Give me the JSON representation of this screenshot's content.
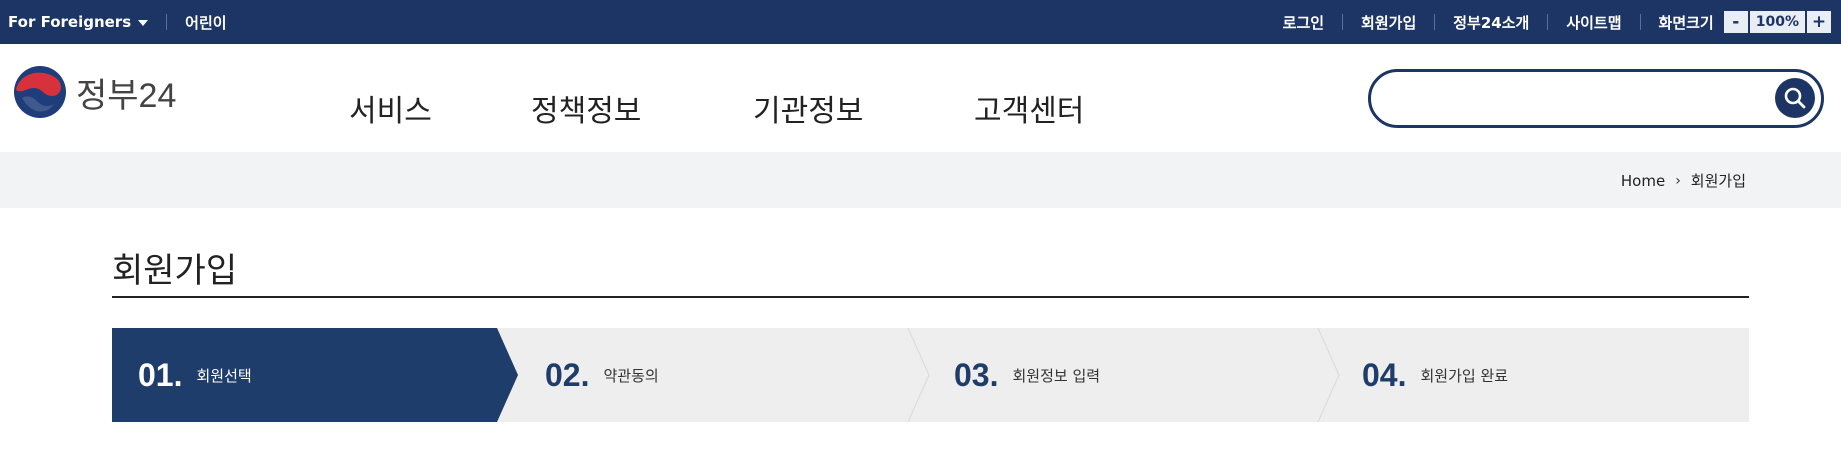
{
  "topbar": {
    "foreigners_label": "For Foreigners",
    "kids_label": "어린이",
    "login_label": "로그인",
    "signup_label": "회원가입",
    "about_label": "정부24소개",
    "sitemap_label": "사이트맵",
    "fontsize_label": "화면크기",
    "fontsize_minus": "-",
    "fontsize_value": "100%",
    "fontsize_plus": "+"
  },
  "header": {
    "logo_text": "정부24",
    "nav": [
      "서비스",
      "정책정보",
      "기관정보",
      "고객센터"
    ],
    "search_placeholder": ""
  },
  "breadcrumb": {
    "home": "Home",
    "separator": "›",
    "current": "회원가입"
  },
  "page": {
    "title": "회원가입"
  },
  "steps": [
    {
      "num": "01.",
      "label": "회원선택",
      "active": true
    },
    {
      "num": "02.",
      "label": "약관동의",
      "active": false
    },
    {
      "num": "03.",
      "label": "회원정보 입력",
      "active": false
    },
    {
      "num": "04.",
      "label": "회원가입 완료",
      "active": false
    }
  ],
  "colors": {
    "brand_navy": "#1d3565",
    "step_active": "#1f3d6b",
    "step_bg": "#eeeeee",
    "logo_red": "#d7323c",
    "logo_blue": "#1f3d7a"
  }
}
